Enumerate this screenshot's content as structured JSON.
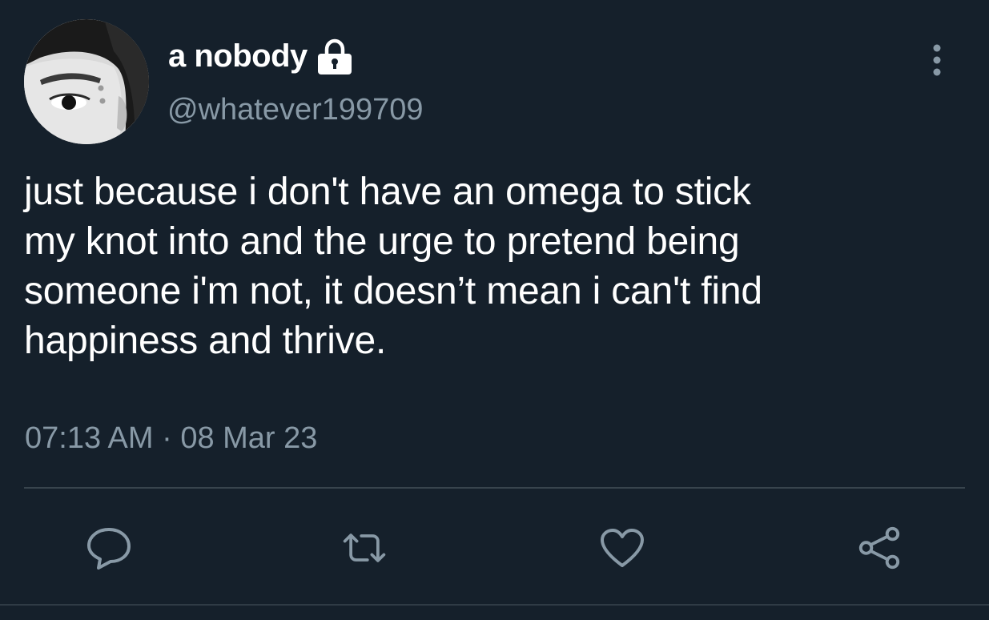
{
  "tweet": {
    "author": {
      "display_name": "a nobody",
      "handle": "@whatever199709",
      "protected_icon": "lock-icon",
      "avatar_icon": "profile-photo"
    },
    "text": "just because i don't have an omega to stick\nmy knot into and the urge to pretend being\nsomeone i'm not, it doesn’t mean i can't find\nhappiness and thrive.",
    "timestamp": "07:13 AM · 08 Mar 23",
    "more_icon": "more-vertical-icon"
  },
  "actions": [
    {
      "name": "reply",
      "icon": "reply-icon"
    },
    {
      "name": "retweet",
      "icon": "retweet-icon"
    },
    {
      "name": "like",
      "icon": "heart-icon"
    },
    {
      "name": "share",
      "icon": "share-icon"
    }
  ],
  "colors": {
    "background": "#15202b",
    "primary_text": "#ffffff",
    "secondary_text": "#8899a6",
    "divider": "#38444d"
  }
}
